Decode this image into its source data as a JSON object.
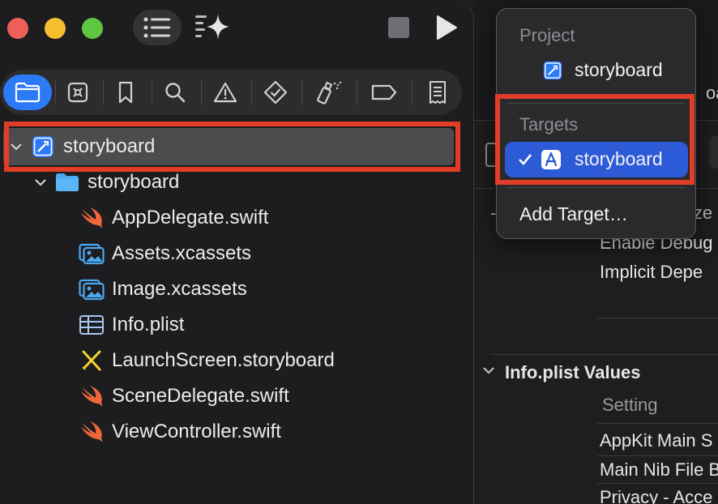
{
  "toolbar": {
    "window_controls": [
      "close",
      "minimize",
      "zoom"
    ],
    "icons": [
      "sidebar-list-icon",
      "sparkle-icon",
      "stop-icon",
      "play-icon"
    ]
  },
  "navigator_tabs": [
    {
      "icon": "folder-icon",
      "active": true
    },
    {
      "icon": "source-control-icon",
      "active": false
    },
    {
      "icon": "bookmark-icon",
      "active": false
    },
    {
      "icon": "search-icon",
      "active": false
    },
    {
      "icon": "warning-icon",
      "active": false
    },
    {
      "icon": "test-diamond-icon",
      "active": false
    },
    {
      "icon": "debug-spray-icon",
      "active": false
    },
    {
      "icon": "tag-icon",
      "active": false
    },
    {
      "icon": "report-icon",
      "active": false
    }
  ],
  "tree": {
    "project": "storyboard",
    "group": "storyboard",
    "files": [
      {
        "name": "AppDelegate.swift",
        "icon": "swift-icon"
      },
      {
        "name": "Assets.xcassets",
        "icon": "asset-catalog-icon"
      },
      {
        "name": "Image.xcassets",
        "icon": "asset-catalog-icon"
      },
      {
        "name": "Info.plist",
        "icon": "plist-table-icon"
      },
      {
        "name": "LaunchScreen.storyboard",
        "icon": "storyboard-icon"
      },
      {
        "name": "SceneDelegate.swift",
        "icon": "swift-icon"
      },
      {
        "name": "ViewController.swift",
        "icon": "swift-icon"
      }
    ]
  },
  "popup": {
    "project_header": "Project",
    "project_item": "storyboard",
    "targets_header": "Targets",
    "target_item": "storyboard",
    "add_target": "Add Target…"
  },
  "editor": {
    "enable_debug": "Enable Debug",
    "implicit": "Implicit Depe",
    "section": "Info.plist Values",
    "setting": "Setting",
    "rows": [
      "AppKit Main S",
      "Main Nib File B",
      "Privacy - Acce"
    ],
    "frag_ize": "ize",
    "frag_oa": "oa",
    "dash": "-"
  },
  "colors": {
    "accent": "#2d7af6",
    "selection": "#2d5bd8",
    "highlight_box": "#e23d28",
    "swift": "#f0663b"
  }
}
